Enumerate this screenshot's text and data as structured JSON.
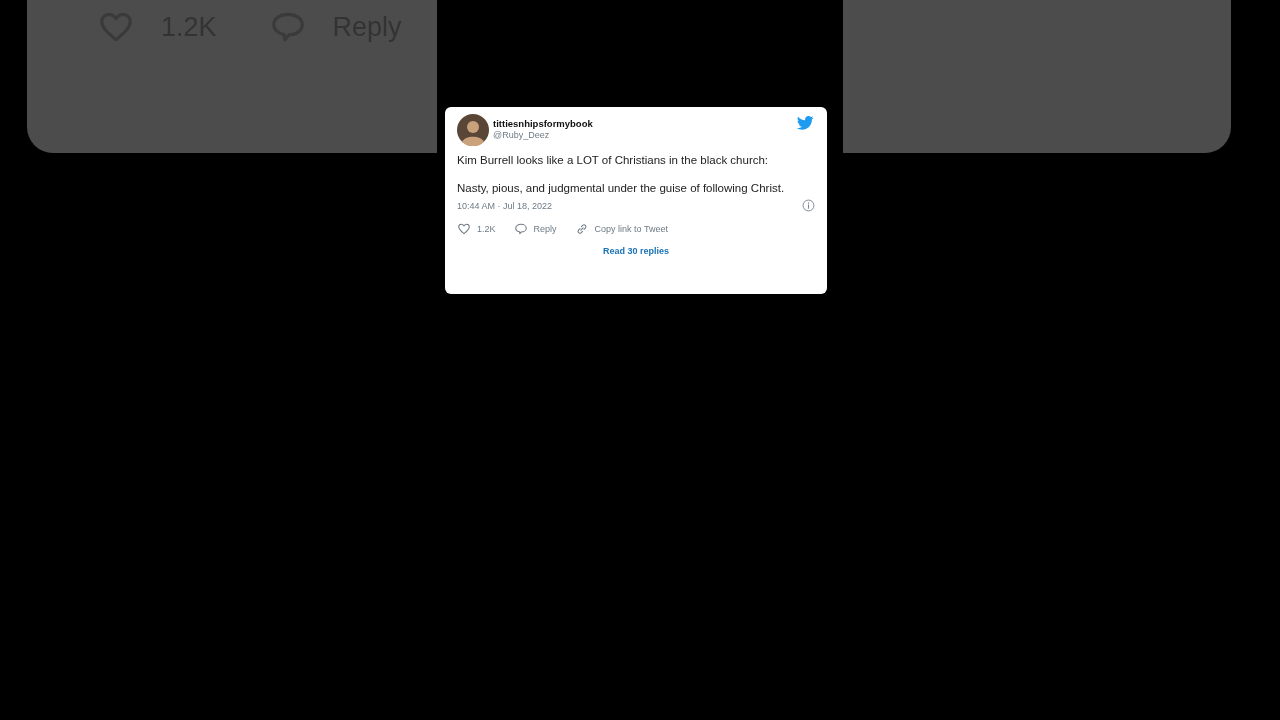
{
  "background_card": {
    "actions": [
      {
        "kind": "like",
        "label": "1.2K"
      },
      {
        "kind": "reply",
        "label": "Reply"
      }
    ]
  },
  "tweet": {
    "display_name": "tittiesnhipsformybook",
    "handle": "@Ruby_Deez",
    "paragraphs": [
      "Kim Burrell looks like a LOT of Christians in the black church:",
      "Nasty, pious, and judgmental under the guise of following Christ."
    ],
    "timestamp": "10:44 AM · Jul 18, 2022",
    "actions": [
      {
        "kind": "like",
        "label": "1.2K"
      },
      {
        "kind": "reply",
        "label": "Reply"
      },
      {
        "kind": "copy_link",
        "label": "Copy link to Tweet"
      }
    ],
    "read_replies": "Read 30 replies"
  }
}
